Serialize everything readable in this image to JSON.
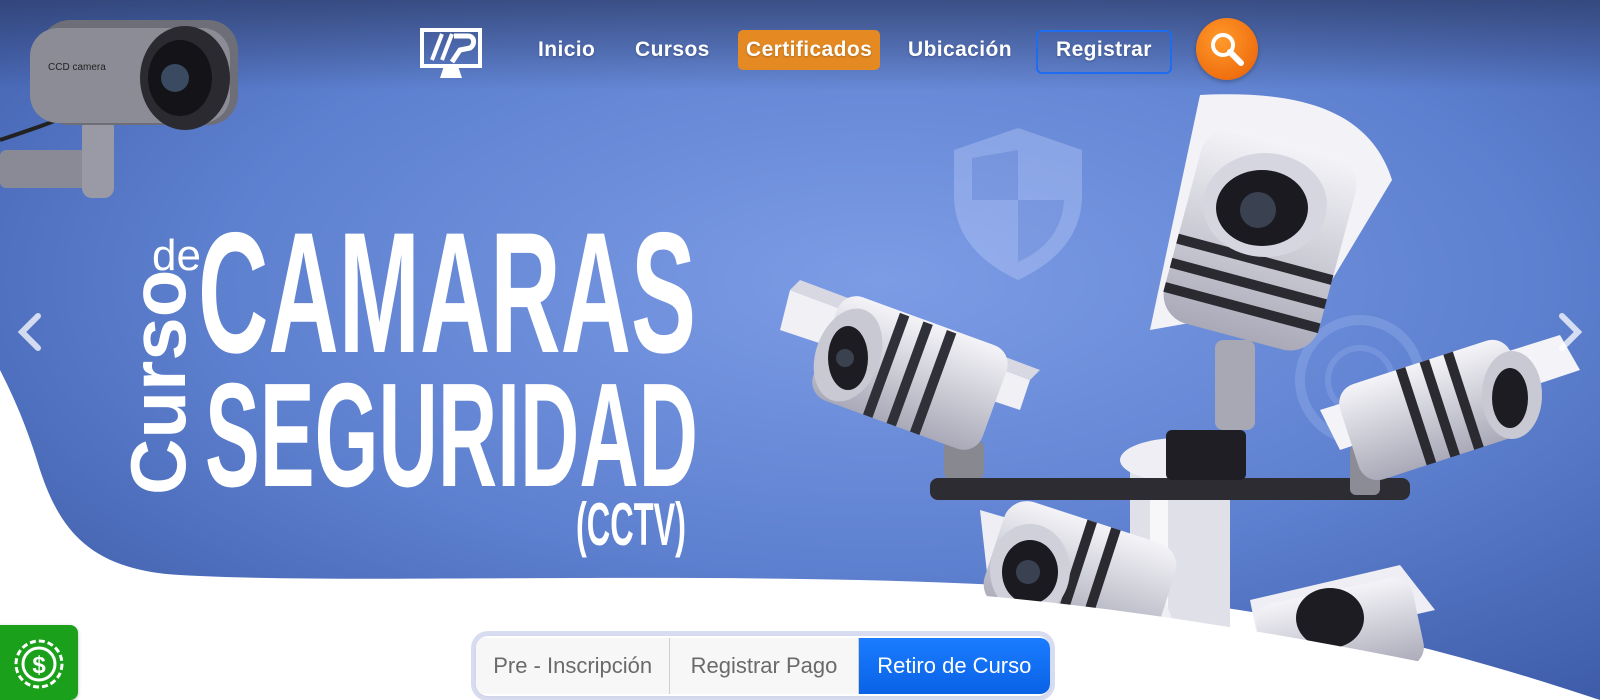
{
  "nav": {
    "items": [
      {
        "label": "Inicio"
      },
      {
        "label": "Cursos"
      },
      {
        "label": "Certificados"
      },
      {
        "label": "Ubicación"
      },
      {
        "label": "Registrar"
      }
    ]
  },
  "hero": {
    "title_curso": "Curso",
    "title_de": "de",
    "title_line1": "CAMARAS",
    "title_line2": "SEGURIDAD",
    "title_abbr": "(CCTV)",
    "camera_label": "CCD camera"
  },
  "actions": {
    "pre_inscripcion": "Pre - Inscripción",
    "registrar_pago": "Registrar Pago",
    "retiro_curso": "Retiro de Curso"
  },
  "colors": {
    "hero_blue": "#5b7fcf",
    "accent_orange": "#e58a22",
    "primary_blue": "#0a62e6",
    "pay_green": "#1aa01a"
  },
  "icons": [
    "logo-icon",
    "search-icon",
    "chevron-left-icon",
    "chevron-right-icon",
    "dollar-coin-icon",
    "shield-icon",
    "security-camera-icon"
  ]
}
